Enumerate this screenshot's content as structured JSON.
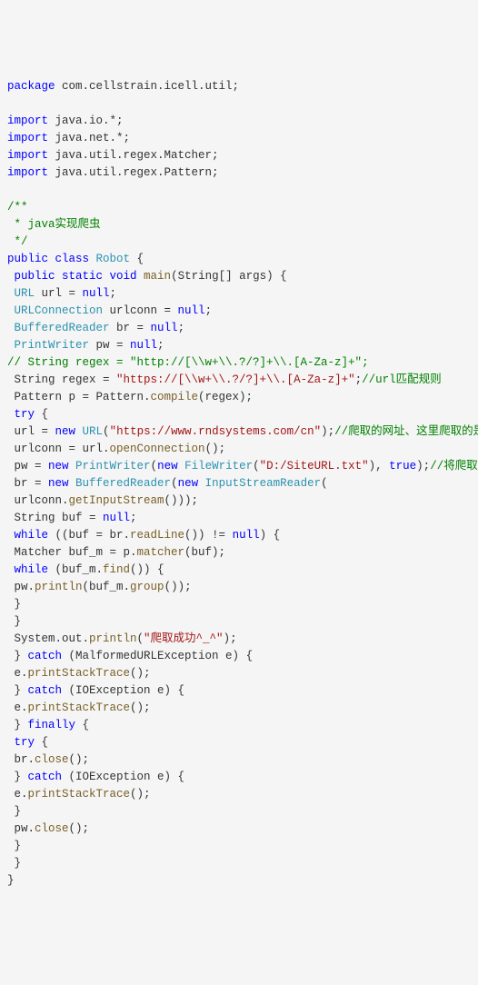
{
  "code": {
    "line1_kw": "package",
    "line1_pkg": " com.cellstrain.icell.util;",
    "line3_kw": "import",
    "line3_pkg": " java.io.*;",
    "line4_kw": "import",
    "line4_pkg": " java.net.*;",
    "line5_kw": "import",
    "line5_pkg": " java.util.regex.Matcher;",
    "line6_kw": "import",
    "line6_pkg": " java.util.regex.Pattern;",
    "line8_com": "/**",
    "line9_com": " * java实现爬虫",
    "line10_com": " */",
    "line11_kw1": "public",
    "line11_kw2": " class",
    "line11_cls": " Robot",
    "line11_rest": " {",
    "line12_kw1": " public",
    "line12_kw2": " static",
    "line12_kw3": " void",
    "line12_method": " main",
    "line12_rest": "(String[] args) {",
    "line13_type": " URL",
    "line13_rest": " url = ",
    "line13_null": "null",
    "line13_end": ";",
    "line14_type": " URLConnection",
    "line14_rest": " urlconn = ",
    "line14_null": "null",
    "line14_end": ";",
    "line15_type": " BufferedReader",
    "line15_rest": " br = ",
    "line15_null": "null",
    "line15_end": ";",
    "line16_type": " PrintWriter",
    "line16_rest": " pw = ",
    "line16_null": "null",
    "line16_end": ";",
    "line17_com": "// String regex = \"http://[\\\\w+\\\\.?/?]+\\\\.[A-Za-z]+\";",
    "line18_pre": " String regex = ",
    "line18_str": "\"https://[\\\\w+\\\\.?/?]+\\\\.[A-Za-z]+\"",
    "line18_end": ";",
    "line18_com": "//url匹配规则",
    "line19_pre": " Pattern p = Pattern.",
    "line19_method": "compile",
    "line19_rest": "(regex);",
    "line20_kw": " try",
    "line20_rest": " {",
    "line21_pre": " url = ",
    "line21_kw": "new",
    "line21_type": " URL",
    "line21_paren": "(",
    "line21_str": "\"https://www.rndsystems.com/cn\"",
    "line21_end": ");",
    "line21_com": "//爬取的网址、这里爬取的是一个生物网站",
    "line22_pre": " urlconn = url.",
    "line22_method": "openConnection",
    "line22_rest": "();",
    "line23_pre": " pw = ",
    "line23_kw1": "new",
    "line23_type1": " PrintWriter",
    "line23_paren1": "(",
    "line23_kw2": "new",
    "line23_type2": " FileWriter",
    "line23_paren2": "(",
    "line23_str": "\"D:/SiteURL.txt\"",
    "line23_rest": "), ",
    "line23_true": "true",
    "line23_end": ");",
    "line23_com": "//将爬取到的链接放到D盘的SiteURL文件中",
    "line24_pre": " br = ",
    "line24_kw": "new",
    "line24_type1": " BufferedReader",
    "line24_paren1": "(",
    "line24_kw2": "new",
    "line24_type2": " InputStreamReader",
    "line24_rest": "(",
    "line25_pre": " urlconn.",
    "line25_method": "getInputStream",
    "line25_rest": "()));",
    "line26_pre": " String buf = ",
    "line26_null": "null",
    "line26_end": ";",
    "line27_kw": " while",
    "line27_rest": " ((buf = br.",
    "line27_method": "readLine",
    "line27_rest2": "()) != ",
    "line27_null": "null",
    "line27_end": ") {",
    "line28_pre": " Matcher buf_m = p.",
    "line28_method": "matcher",
    "line28_rest": "(buf);",
    "line29_kw": " while",
    "line29_rest": " (buf_m.",
    "line29_method": "find",
    "line29_rest2": "()) {",
    "line30_pre": " pw.",
    "line30_method": "println",
    "line30_rest": "(buf_m.",
    "line30_method2": "group",
    "line30_rest2": "());",
    "line31": " }",
    "line32": " }",
    "line33_pre": " System.out.",
    "line33_method": "println",
    "line33_paren": "(",
    "line33_str": "\"爬取成功^_^\"",
    "line33_end": ");",
    "line34_pre": " } ",
    "line34_kw": "catch",
    "line34_rest": " (MalformedURLException e) {",
    "line35_pre": " e.",
    "line35_method": "printStackTrace",
    "line35_rest": "();",
    "line36_pre": " } ",
    "line36_kw": "catch",
    "line36_rest": " (IOException e) {",
    "line37_pre": " e.",
    "line37_method": "printStackTrace",
    "line37_rest": "();",
    "line38_pre": " } ",
    "line38_kw": "finally",
    "line38_rest": " {",
    "line39_kw": " try",
    "line39_rest": " {",
    "line40_pre": " br.",
    "line40_method": "close",
    "line40_rest": "();",
    "line41_pre": " } ",
    "line41_kw": "catch",
    "line41_rest": " (IOException e) {",
    "line42_pre": " e.",
    "line42_method": "printStackTrace",
    "line42_rest": "();",
    "line43": " }",
    "line44_pre": " pw.",
    "line44_method": "close",
    "line44_rest": "();",
    "line45": " }",
    "line46": " }",
    "line47": "}"
  }
}
